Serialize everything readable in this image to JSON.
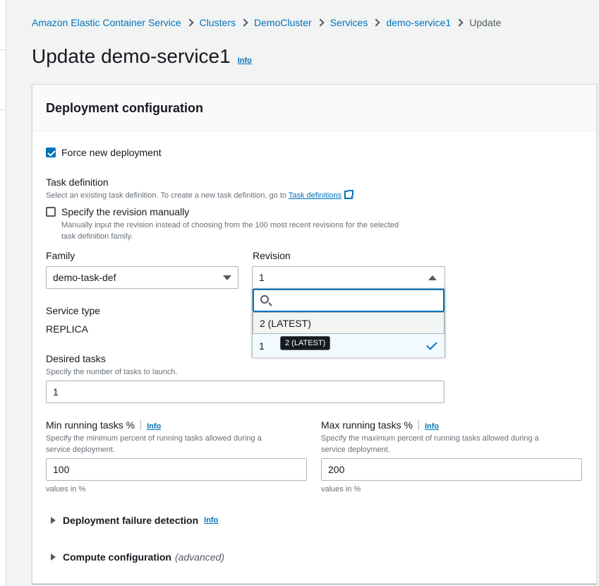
{
  "breadcrumb": {
    "items": [
      "Amazon Elastic Container Service",
      "Clusters",
      "DemoCluster",
      "Services",
      "demo-service1"
    ],
    "current": "Update"
  },
  "page": {
    "title": "Update demo-service1",
    "info": "Info"
  },
  "panel": {
    "title": "Deployment configuration",
    "force_new_deployment": {
      "label": "Force new deployment",
      "checked": true
    },
    "task_definition": {
      "label": "Task definition",
      "desc_prefix": "Select an existing task definition. To create a new task definition, go to ",
      "desc_link": "Task definitions",
      "desc_suffix": ".",
      "specify_manually": {
        "label": "Specify the revision manually",
        "checked": false,
        "desc_line1": "Manually input the revision instead of choosing from the 100 most recent revisions for the selected",
        "desc_line2": "task definition family."
      }
    },
    "family": {
      "label": "Family",
      "value": "demo-task-def"
    },
    "revision": {
      "label": "Revision",
      "value": "1",
      "search_placeholder": "",
      "options": [
        "2 (LATEST)",
        "1"
      ],
      "selected": "1",
      "tooltip": "2 (LATEST)"
    },
    "service_type": {
      "label": "Service type",
      "value": "REPLICA"
    },
    "desired_tasks": {
      "label": "Desired tasks",
      "desc": "Specify the number of tasks to launch.",
      "value": "1"
    },
    "min_running": {
      "label": "Min running tasks %",
      "info": "Info",
      "desc_line1": "Specify the minimum percent of running tasks allowed during a",
      "desc_line2": "service deployment.",
      "value": "100",
      "hint": "values in %"
    },
    "max_running": {
      "label": "Max running tasks %",
      "info": "Info",
      "desc_line1": "Specify the maximum percent of running tasks allowed during a",
      "desc_line2": "service deployment.",
      "value": "200",
      "hint": "values in %"
    },
    "deployment_failure": {
      "label": "Deployment failure detection",
      "info": "Info"
    },
    "compute_config": {
      "label": "Compute configuration",
      "suffix": "(advanced)"
    }
  },
  "colors": {
    "link": "#0073bb",
    "text": "#16191f",
    "muted": "#687078",
    "background": "#f2f3f3"
  }
}
